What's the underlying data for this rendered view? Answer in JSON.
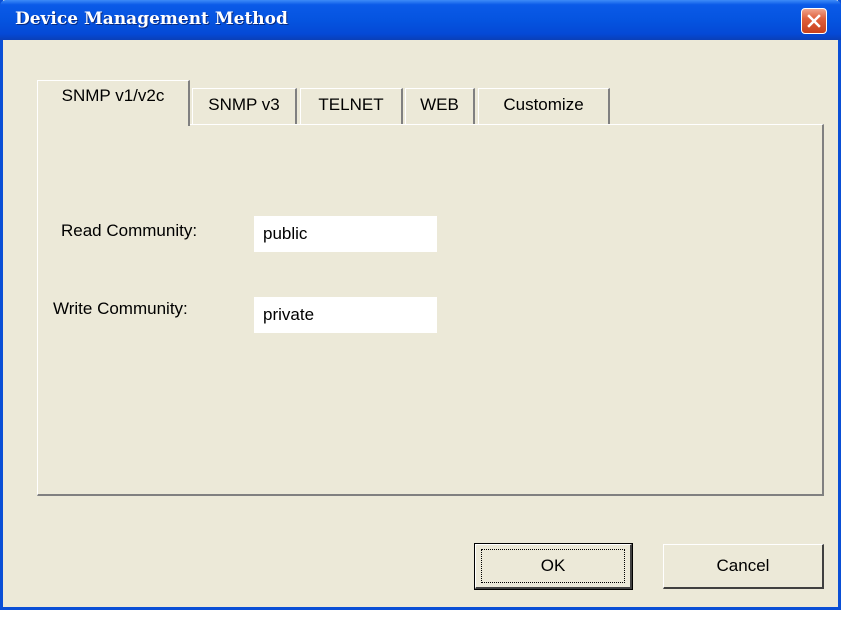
{
  "window": {
    "title": "Device Management Method"
  },
  "icons": {
    "close": "close-icon"
  },
  "colors": {
    "titlebar": "#0554e0",
    "window_bg": "#ece9d8",
    "close_button": "#e0603c"
  },
  "tabs": [
    {
      "label": "SNMP v1/v2c",
      "active": true
    },
    {
      "label": "SNMP v3",
      "active": false
    },
    {
      "label": "TELNET",
      "active": false
    },
    {
      "label": "WEB",
      "active": false
    },
    {
      "label": "Customize",
      "active": false
    }
  ],
  "form": {
    "read_community_label": "Read Community:",
    "read_community_value": "public",
    "write_community_label": "Write Community:",
    "write_community_value": "private"
  },
  "buttons": {
    "ok_label": "OK",
    "cancel_label": "Cancel"
  }
}
